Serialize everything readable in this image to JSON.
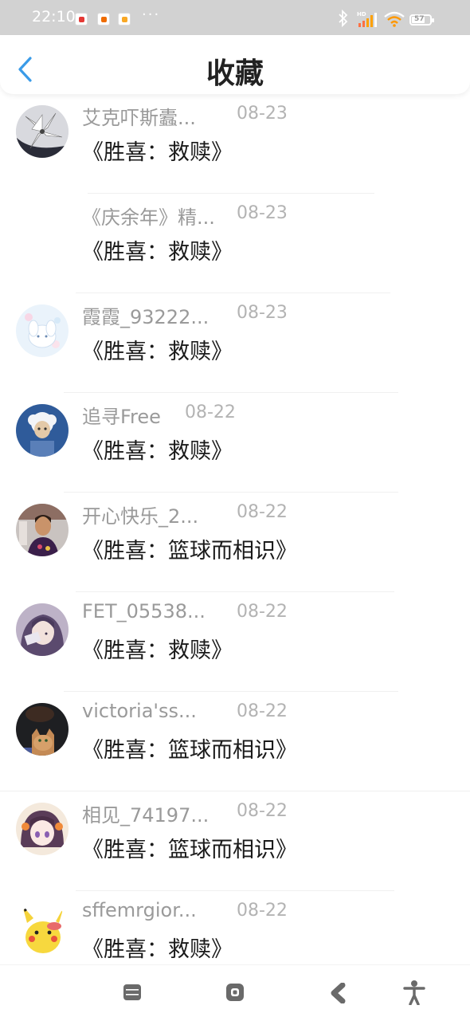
{
  "status_bar": {
    "time": "22:10",
    "more": "···",
    "network_label": "HD",
    "battery_level": "57",
    "notification_icons": [
      "app-notification-icon",
      "app-notification-icon",
      "app-notification-icon"
    ],
    "colors": {
      "background": "#d2d2d2",
      "text": "#ffffff"
    }
  },
  "header": {
    "title": "收藏",
    "back_icon": "chevron-left-icon",
    "accent_color": "#3a9be8"
  },
  "favorites": [
    {
      "username": "艾克吓斯蠹...",
      "date": "08-23",
      "title": "《胜喜：救赎》",
      "avatar": "flower-avatar"
    },
    {
      "username": "《庆余年》精...",
      "date": "08-23",
      "title": "《胜喜：救赎》",
      "avatar": "none"
    },
    {
      "username": "霞霞_93222...",
      "date": "08-23",
      "title": "《胜喜：救赎》",
      "avatar": "cartoon-avatar"
    },
    {
      "username": "追寻Free",
      "date": "08-22",
      "title": "《胜喜：救赎》",
      "avatar": "sheep-avatar"
    },
    {
      "username": "开心快乐_2...",
      "date": "08-22",
      "title": "《胜喜：篮球而相识》",
      "avatar": "person-avatar"
    },
    {
      "username": "FET_05538...",
      "date": "08-22",
      "title": "《胜喜：救赎》",
      "avatar": "anime-girl-avatar"
    },
    {
      "username": "victoria'ss...",
      "date": "08-22",
      "title": "《胜喜：篮球而相识》",
      "avatar": "cat-avatar"
    },
    {
      "username": "相见_74197...",
      "date": "08-22",
      "title": "《胜喜：篮球而相识》",
      "avatar": "anime-avatar"
    },
    {
      "username": "sffemrgior...",
      "date": "08-22",
      "title": "《胜喜：救赎》",
      "avatar": "pikachu-avatar"
    }
  ],
  "nav_bar": {
    "buttons": [
      "menu-icon",
      "home-icon",
      "back-icon",
      "accessibility-icon"
    ]
  }
}
